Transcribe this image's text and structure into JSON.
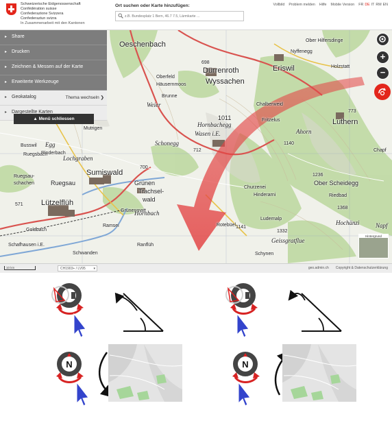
{
  "header": {
    "federal_lines": [
      "Schweizerische Eidgenossenschaft",
      "Confédération suisse",
      "Confederazione Svizzera",
      "Confederaziun svizra"
    ],
    "federal_sub": "In Zusammenarbeit mit den Kantonen",
    "search_label": "Ort suchen oder Karte hinzufügen:",
    "search_placeholder": "z.B. Bundesplatz 1 Bern, 46.7 7.5, Lärmkarte ...",
    "links": [
      "Vollbild",
      "Problem melden",
      "Hilfe",
      "Mobile Version"
    ],
    "languages": [
      "FR",
      "DE",
      "IT",
      "RM",
      "EN"
    ],
    "active_language": "DE"
  },
  "menu": {
    "items": [
      "Share",
      "Drucken",
      "Zeichnen & Messen auf der Karte",
      "Erweiterte Werkzeuge"
    ],
    "geokatalog": "Geokatalog",
    "theme_switch": "Thema wechseln",
    "selected_maps": "Dargestellte Karten",
    "close_label": "Menü schliessen"
  },
  "map": {
    "places_large": [
      "Sumiswald",
      "Lützelflüh",
      "Dürrenroth",
      "Wyssachen",
      "Eriswil",
      "Luthern",
      "Ruegsau",
      "Grünen",
      "Trachsel-",
      "wald",
      "Wasen i.E.",
      "Oeschenbach",
      "Weier",
      "Hornbachegg",
      "Ahorn"
    ],
    "places_small": [
      "Mutrigen",
      "Ruegsbach",
      "Ruegsau-",
      "schachen",
      "Goldbach",
      "Schafhausen i.E.",
      "Ramsei",
      "Ranflüh",
      "Grünenmatt",
      "Busswil",
      "Rinderbach",
      "Oberfeld",
      "Häusernmoos",
      "Brunne",
      "Fritzelus",
      "Ober Scheidegg",
      "Churzenei",
      "Hinderarni",
      "Ludernalp",
      "Geissgratflue",
      "Rotebüel",
      "Schwanden",
      "Hochänzi",
      "Riedbad",
      "Holzstatt",
      "Nyffenegg",
      "Ober Hilfersdinge",
      "Chalberweid",
      "Chapf",
      "Egg",
      "Hornbach",
      "Schonegg",
      "Lochgraben",
      "Napf",
      "Schynen"
    ],
    "map_numbers": [
      "698",
      "773",
      "1140",
      "1236",
      "1368",
      "1332",
      "1141",
      "712",
      "700",
      "571",
      "1011"
    ],
    "background_label": "Hintergrund",
    "controls": [
      "location-icon",
      "zoom-in-icon",
      "zoom-out-icon"
    ]
  },
  "footer": {
    "scale": "10 km",
    "projection": "CH1903+ / LV95",
    "source": "geo.admin.ch",
    "copyright": "Copyright & Datenschutzerklärung"
  },
  "colors": {
    "swiss_red": "#e3261b",
    "menu_gray": "#7d7d7d",
    "arrow_red": "#e34545",
    "cursor_blue": "#3344cc"
  }
}
